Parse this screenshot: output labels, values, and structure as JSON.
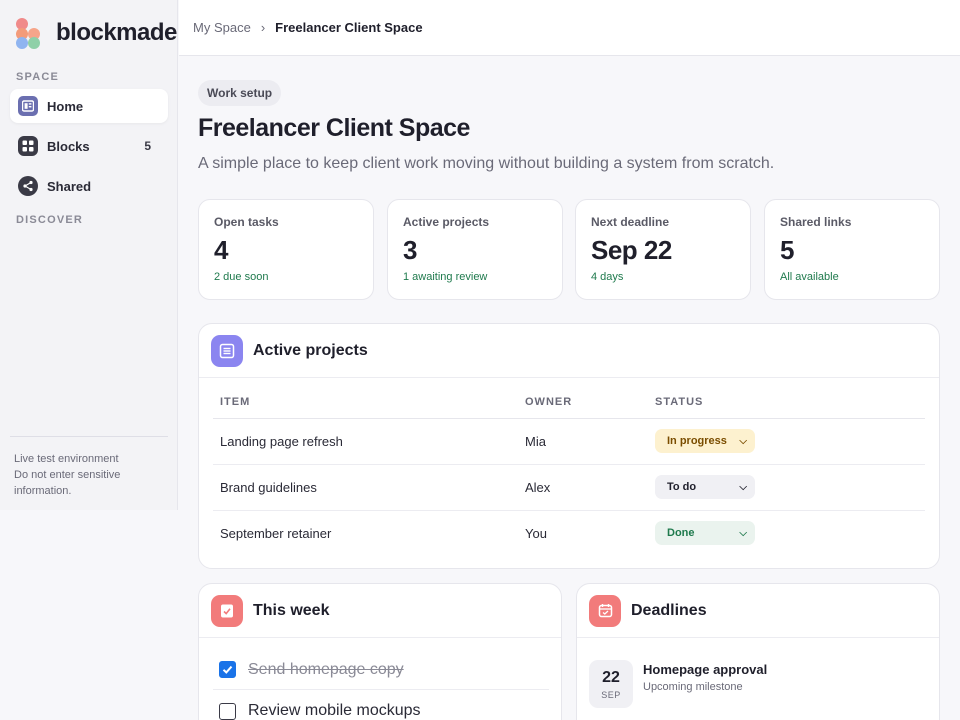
{
  "app": {
    "name": "blockmade"
  },
  "sidebar": {
    "space_label": "SPACE",
    "discover_label": "DISCOVER",
    "items": [
      {
        "label": "Home",
        "icon": "home-icon",
        "active": true
      },
      {
        "label": "Blocks",
        "icon": "blocks-icon",
        "count": "5"
      },
      {
        "label": "Shared",
        "icon": "share-icon"
      }
    ],
    "note_line1": "Live test environment",
    "note_line2": "Do not enter sensitive",
    "note_line3": "information."
  },
  "breadcrumb": {
    "root": "My Space",
    "separator": "›",
    "current": "Freelancer Client Space"
  },
  "page": {
    "chip": "Work setup",
    "title": "Freelancer Client Space",
    "subtitle": "A simple place to keep client work moving without building a system from scratch."
  },
  "stats": [
    {
      "label": "Open tasks",
      "value": "4",
      "note": "2 due soon"
    },
    {
      "label": "Active projects",
      "value": "3",
      "note": "1 awaiting review"
    },
    {
      "label": "Next deadline",
      "value": "Sep 22",
      "note": "4 days"
    },
    {
      "label": "Shared links",
      "value": "5",
      "note": "All available"
    }
  ],
  "projects": {
    "title": "Active projects",
    "columns": [
      "ITEM",
      "OWNER",
      "STATUS"
    ],
    "rows": [
      {
        "item": "Landing page refresh",
        "owner": "Mia",
        "status": "In progress"
      },
      {
        "item": "Brand guidelines",
        "owner": "Alex",
        "status": "To do"
      },
      {
        "item": "September retainer",
        "owner": "You",
        "status": "Done"
      }
    ]
  },
  "this_week": {
    "title": "This week",
    "tasks": [
      {
        "label": "Send homepage copy",
        "done": true
      },
      {
        "label": "Review mobile mockups",
        "done": false
      }
    ]
  },
  "deadlines": {
    "title": "Deadlines",
    "items": [
      {
        "day": "22",
        "month": "SEP",
        "title": "Homepage approval",
        "subtitle": "Upcoming milestone"
      }
    ]
  },
  "colors": {
    "accent_purple": "#8b85f0",
    "accent_red": "#f27b7b",
    "status_progress_bg": "#fdf1cf",
    "status_done_bg": "#eaf3ee",
    "note_green": "#1f7a4d"
  }
}
